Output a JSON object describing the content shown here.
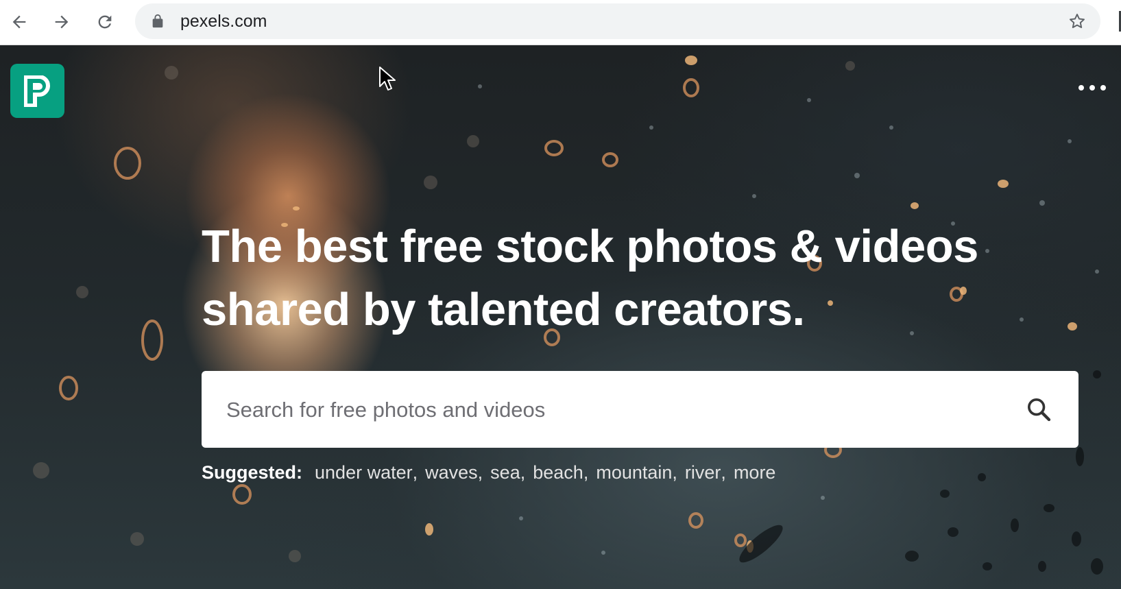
{
  "browser": {
    "url": "pexels.com"
  },
  "header": {
    "logo_icon": "pexels-logo-icon",
    "menu_icon": "more-dots-icon"
  },
  "hero": {
    "headline": "The best free stock photos & videos shared by talented creators.",
    "search": {
      "placeholder": "Search for free photos and videos",
      "value": ""
    },
    "suggested": {
      "label": "Suggested:",
      "tags": [
        "under water",
        "waves",
        "sea",
        "beach",
        "mountain",
        "river",
        "more"
      ]
    }
  },
  "colors": {
    "brand": "#07a081",
    "text_on_hero": "#ffffff",
    "omnibox_bg": "#f1f3f4"
  }
}
